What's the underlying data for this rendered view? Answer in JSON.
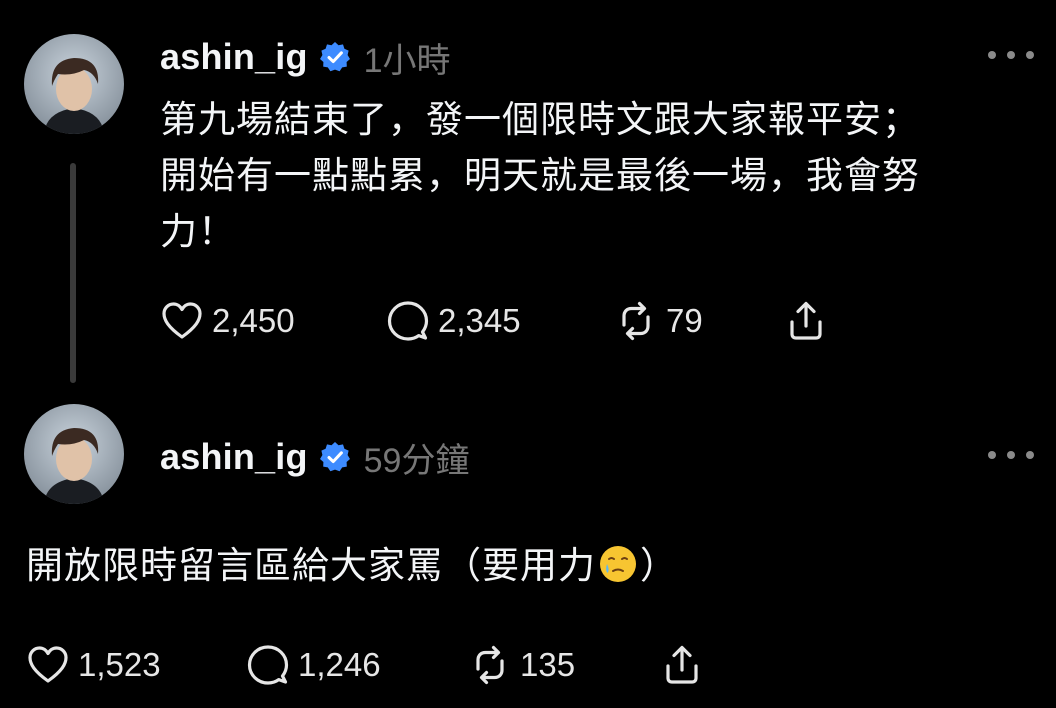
{
  "colors": {
    "background": "#000000",
    "text": "#f3f5f7",
    "muted": "#777777",
    "verified": "#3d8bff"
  },
  "posts": [
    {
      "username": "ashin_ig",
      "verified": true,
      "timestamp": "1小時",
      "text": "第九場結束了，發一個限時文跟大家報平安；\n開始有一點點累，明天就是最後一場，我會努\n力！",
      "likes": "2,450",
      "comments": "2,345",
      "reposts": "79"
    },
    {
      "username": "ashin_ig",
      "verified": true,
      "timestamp": "59分鐘",
      "text_before_emoji": "開放限時留言區給大家罵（要用力",
      "emoji": "face-holding-back-tears",
      "text_after_emoji": "）",
      "likes": "1,523",
      "comments": "1,246",
      "reposts": "135"
    }
  ],
  "icons": {
    "like": "heart-icon",
    "comment": "comment-icon",
    "repost": "repost-icon",
    "share": "share-icon",
    "more": "more-options-icon",
    "verified": "verified-badge-icon"
  }
}
